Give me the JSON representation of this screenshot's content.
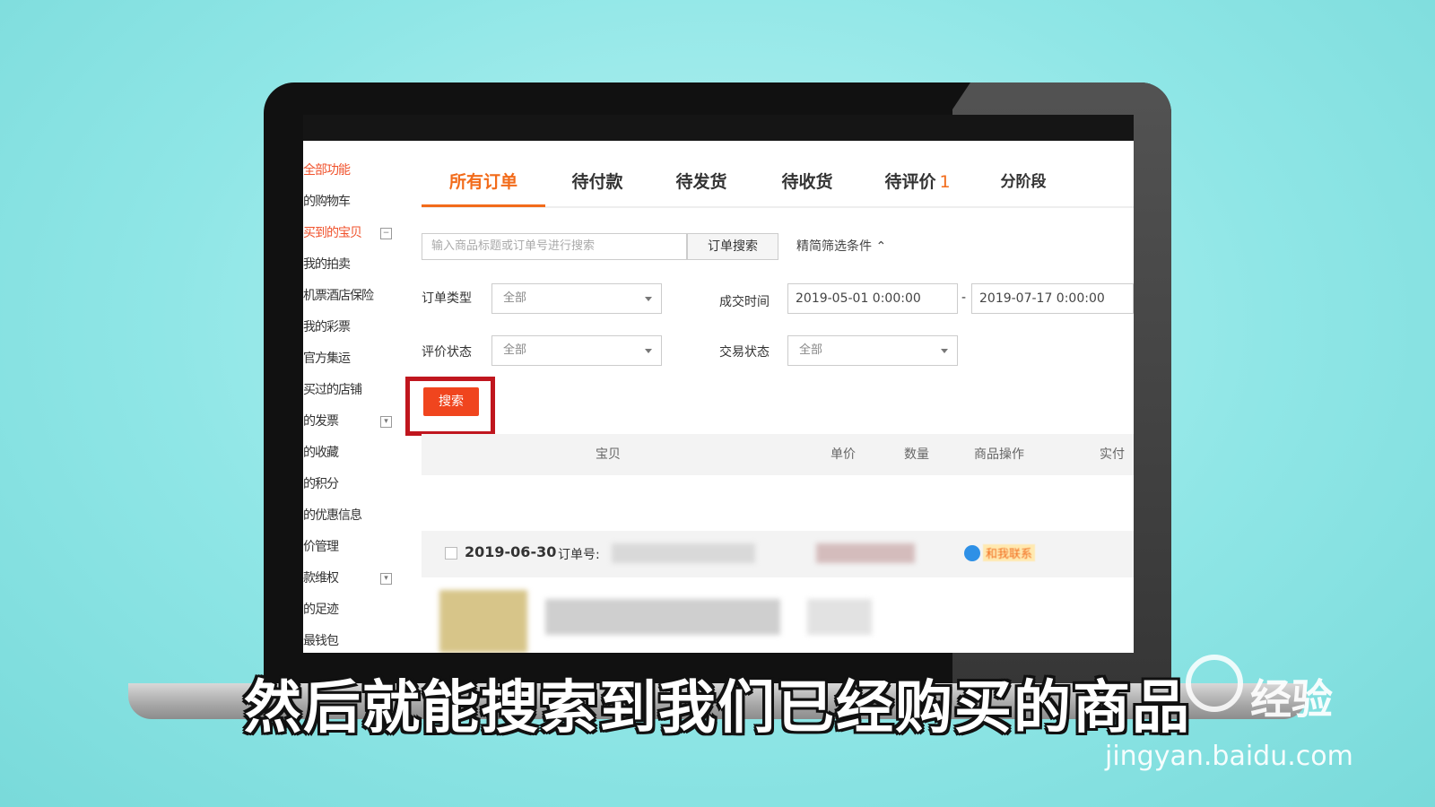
{
  "sidebar": {
    "items": [
      {
        "label": "全部功能",
        "collapse": ""
      },
      {
        "label": "的购物车",
        "collapse": ""
      },
      {
        "label": "买到的宝贝",
        "collapse": "−"
      },
      {
        "label": "我的拍卖",
        "collapse": ""
      },
      {
        "label": "机票酒店保险",
        "collapse": ""
      },
      {
        "label": "我的彩票",
        "collapse": ""
      },
      {
        "label": "官方集运",
        "collapse": ""
      },
      {
        "label": "买过的店铺",
        "collapse": ""
      },
      {
        "label": "的发票",
        "collapse": "▾"
      },
      {
        "label": "的收藏",
        "collapse": ""
      },
      {
        "label": "的积分",
        "collapse": ""
      },
      {
        "label": "的优惠信息",
        "collapse": ""
      },
      {
        "label": "价管理",
        "collapse": ""
      },
      {
        "label": "款维权",
        "collapse": "▾"
      },
      {
        "label": "的足迹",
        "collapse": ""
      },
      {
        "label": "最钱包",
        "collapse": ""
      }
    ]
  },
  "tabs": [
    {
      "label": "所有订单",
      "badge": ""
    },
    {
      "label": "待付款",
      "badge": ""
    },
    {
      "label": "待发货",
      "badge": ""
    },
    {
      "label": "待收货",
      "badge": ""
    },
    {
      "label": "待评价",
      "badge": "1"
    },
    {
      "label": "分阶段",
      "badge": ""
    }
  ],
  "search": {
    "placeholder": "输入商品标题或订单号进行搜索",
    "button": "订单搜索",
    "filter_link": "精简筛选条件"
  },
  "filters": {
    "order_type_label": "订单类型",
    "order_type_value": "全部",
    "deal_time_label": "成交时间",
    "date_from": "2019-05-01 0:00:00",
    "date_to": "2019-07-17 0:00:00",
    "date_sep": "-",
    "review_status_label": "评价状态",
    "review_status_value": "全部",
    "trade_status_label": "交易状态",
    "trade_status_value": "全部",
    "search_button": "搜索"
  },
  "table": {
    "headers": [
      "宝贝",
      "单价",
      "数量",
      "商品操作",
      "实付"
    ]
  },
  "order": {
    "date": "2019-06-30",
    "order_no_label": "订单号:",
    "contact": "和我联系"
  },
  "caption": "然后就能搜索到我们已经购买的商品",
  "watermark": {
    "text": "经验",
    "url": "jingyan.baidu.com"
  },
  "colors": {
    "accent": "#f26b1a",
    "search_button": "#f0451e",
    "highlight": "#c0161e",
    "background": "#8fe6e6"
  }
}
